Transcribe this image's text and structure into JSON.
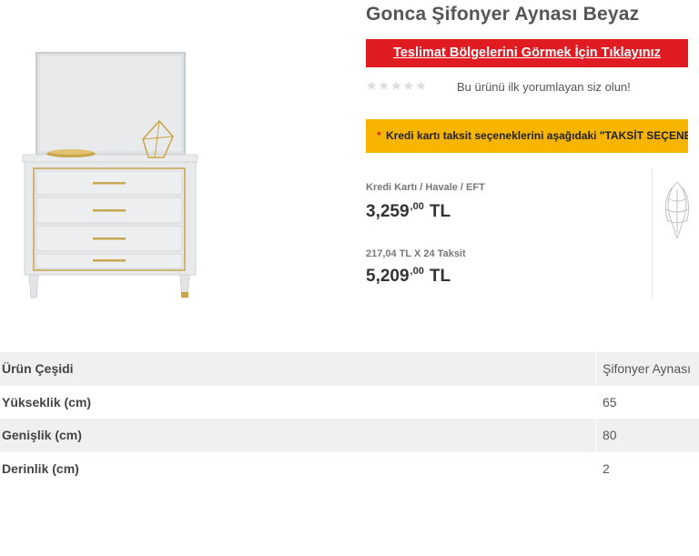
{
  "product": {
    "title": "Gonca Şifonyer Aynası Beyaz",
    "image_icon": "dresser-mirror-image"
  },
  "delivery_banner": {
    "label": "Teslimat Bölgelerini Görmek İçin Tıklayınız",
    "color": "#e11b22"
  },
  "rating": {
    "stars": "★★★★★",
    "text": "Bu ürünü ilk yorumlayan siz olun!"
  },
  "installment_banner": {
    "asterisk": "*",
    "text": "Kredi kartı taksit seçeneklerini aşağıdaki \"TAKSİT SEÇENEKLERİ\"",
    "color": "#f7b500"
  },
  "pricing": {
    "cash_label": "Kredi Kartı / Havale / EFT",
    "cash_price_int": "3,259",
    "cash_price_dec": ",00",
    "cash_currency": "TL",
    "installment_label": "217,04 TL X 24 Taksit",
    "installment_price_int": "5,209",
    "installment_price_dec": ",00",
    "installment_currency": "TL"
  },
  "badge": {
    "icon": "decorative-pattern-icon"
  },
  "specs": [
    {
      "key": "Ürün Çeşidi",
      "value": "Şifonyer Aynası"
    },
    {
      "key": "Yükseklik (cm)",
      "value": "65"
    },
    {
      "key": "Genişlik (cm)",
      "value": "80"
    },
    {
      "key": "Derinlik (cm)",
      "value": "2"
    }
  ]
}
